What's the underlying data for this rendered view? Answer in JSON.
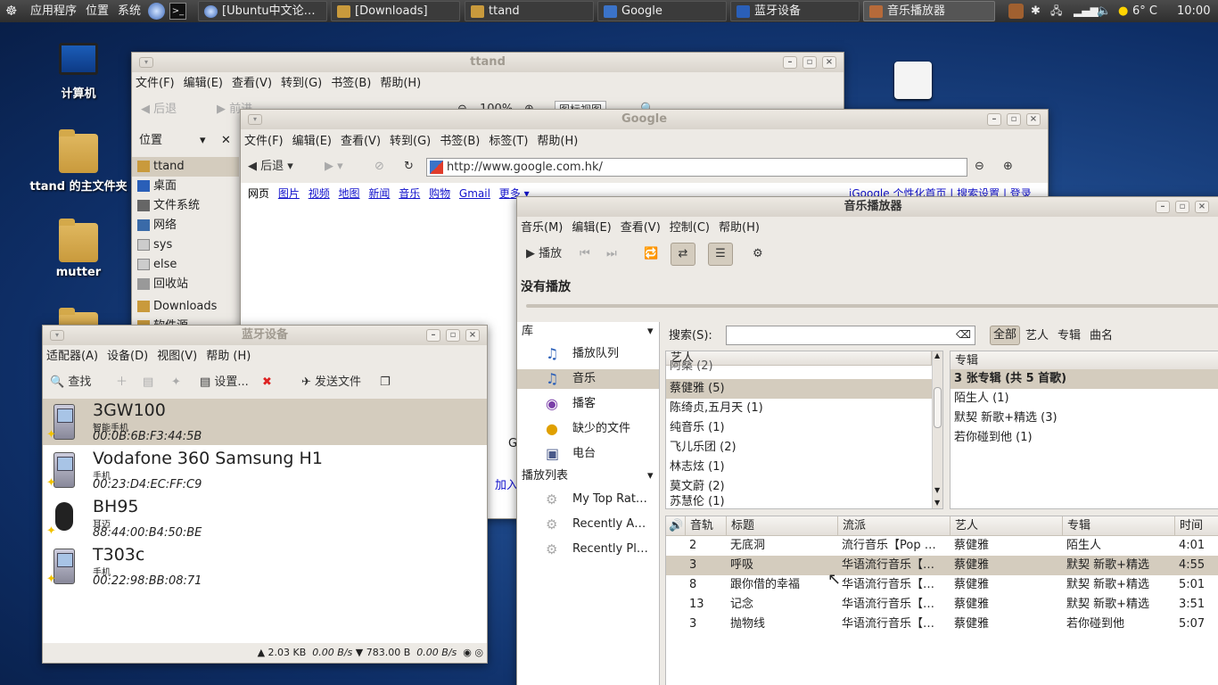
{
  "panel": {
    "apps": "应用程序",
    "places": "位置",
    "system": "系统",
    "weather": "6° C",
    "clock": "10:00",
    "tasks": [
      "[Ubuntu中文论…",
      "[Downloads]",
      "ttand",
      "Google",
      "蓝牙设备",
      "音乐播放器"
    ]
  },
  "desktop": {
    "icons": [
      "计算机",
      "ttand 的主文件夹",
      "mutter"
    ]
  },
  "ttand": {
    "title": "ttand",
    "menu": [
      "文件(F)",
      "编辑(E)",
      "查看(V)",
      "转到(G)",
      "书签(B)",
      "帮助(H)"
    ],
    "back": "后退",
    "forward": "前进",
    "zoom": "100%",
    "view": "图标视图",
    "places_label": "位置",
    "places": [
      "ttand",
      "桌面",
      "文件系统",
      "网络",
      "sys",
      "else",
      "回收站",
      "Downloads",
      "软件源"
    ]
  },
  "google": {
    "title": "Google",
    "menu": [
      "文件(F)",
      "编辑(E)",
      "查看(V)",
      "转到(G)",
      "书签(B)",
      "标签(T)",
      "帮助(H)"
    ],
    "back": "后退",
    "url": "http://www.google.com.hk/",
    "links": [
      "网页",
      "图片",
      "视频",
      "地图",
      "新闻",
      "音乐",
      "购物",
      "Gmail",
      "更多 ▾"
    ],
    "right_links": "iGoogle 个性化首页 | 搜索设置 | 登录",
    "frag1": "G",
    "frag2": "加入"
  },
  "music": {
    "title": "音乐播放器",
    "menu": [
      "音乐(M)",
      "编辑(E)",
      "查看(V)",
      "控制(C)",
      "帮助(H)"
    ],
    "play": "播放",
    "status": "没有播放",
    "library_label": "库",
    "library": [
      "播放队列",
      "音乐",
      "播客",
      "缺少的文件",
      "电台"
    ],
    "playlists_label": "播放列表",
    "playlists": [
      "My Top Rat…",
      "Recently A…",
      "Recently Pl…"
    ],
    "search_label": "搜索(S):",
    "filters": [
      "全部",
      "艺人",
      "专辑",
      "曲名"
    ],
    "artist_header": "艺人",
    "artists": [
      "阿桑 (2)",
      "蔡健雅 (5)",
      "陈绮贞,五月天 (1)",
      "纯音乐 (1)",
      "飞儿乐团 (2)",
      "林志炫 (1)",
      "莫文蔚 (2)",
      "苏慧伦 (1)"
    ],
    "album_header": "专辑",
    "albums": [
      "3 张专辑 (共 5 首歌)",
      "陌生人 (1)",
      "默契 新歌+精选 (3)",
      "若你碰到他 (1)"
    ],
    "track_headers": [
      "音轨",
      "标题",
      "流派",
      "艺人",
      "专辑",
      "时间"
    ],
    "tracks": [
      {
        "num": "2",
        "title": "无底洞",
        "genre": "流行音乐【Pop …",
        "artist": "蔡健雅",
        "album": "陌生人",
        "time": "4:01"
      },
      {
        "num": "3",
        "title": "呼吸",
        "genre": "华语流行音乐【…",
        "artist": "蔡健雅",
        "album": "默契 新歌+精选",
        "time": "4:55"
      },
      {
        "num": "8",
        "title": "跟你借的幸福",
        "genre": "华语流行音乐【…",
        "artist": "蔡健雅",
        "album": "默契 新歌+精选",
        "time": "5:01"
      },
      {
        "num": "13",
        "title": "记念",
        "genre": "华语流行音乐【…",
        "artist": "蔡健雅",
        "album": "默契 新歌+精选",
        "time": "3:51"
      },
      {
        "num": "3",
        "title": "抛物线",
        "genre": "华语流行音乐【…",
        "artist": "蔡健雅",
        "album": "若你碰到他",
        "time": "5:07"
      }
    ]
  },
  "bt": {
    "title": "蓝牙设备",
    "menu": [
      "适配器(A)",
      "设备(D)",
      "视图(V)",
      "帮助 (H)"
    ],
    "search": "查找",
    "settings": "设置...",
    "send": "发送文件",
    "devices": [
      {
        "name": "3GW100",
        "type": "智能手机",
        "addr": "00:0B:6B:F3:44:5B"
      },
      {
        "name": "Vodafone 360 Samsung H1",
        "type": "手机",
        "addr": "00:23:D4:EC:FF:C9"
      },
      {
        "name": "BH95",
        "type": "耳迈",
        "addr": "88:44:00:B4:50:BE"
      },
      {
        "name": "T303c",
        "type": "手机",
        "addr": "00:22:98:BB:08:71"
      }
    ],
    "status_up": "2.03 KB",
    "status_up_rate": "0.00 B/s",
    "status_down": "783.00 B",
    "status_down_rate": "0.00 B/s"
  }
}
